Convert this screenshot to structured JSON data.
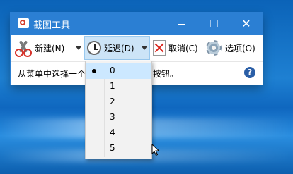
{
  "window": {
    "title": "截图工具",
    "controls": {
      "minimize": "",
      "maximize": "",
      "close": "✕"
    }
  },
  "toolbar": {
    "new_label": "新建(N)",
    "delay_label": "延迟(D)",
    "cancel_label": "取消(C)",
    "options_label": "选项(O)"
  },
  "status": {
    "text": "从菜单中选择一个模式或单击\"新建\"按钮。",
    "help": "?"
  },
  "delay_menu": {
    "items": [
      {
        "label": "0",
        "selected": true
      },
      {
        "label": "1",
        "selected": false
      },
      {
        "label": "2",
        "selected": false
      },
      {
        "label": "3",
        "selected": false
      },
      {
        "label": "4",
        "selected": false
      },
      {
        "label": "5",
        "selected": false
      }
    ]
  },
  "colors": {
    "titlebar": "#2b7fd3",
    "menu_highlight": "#cce8ff",
    "button_pressed": "#cce4f7"
  }
}
